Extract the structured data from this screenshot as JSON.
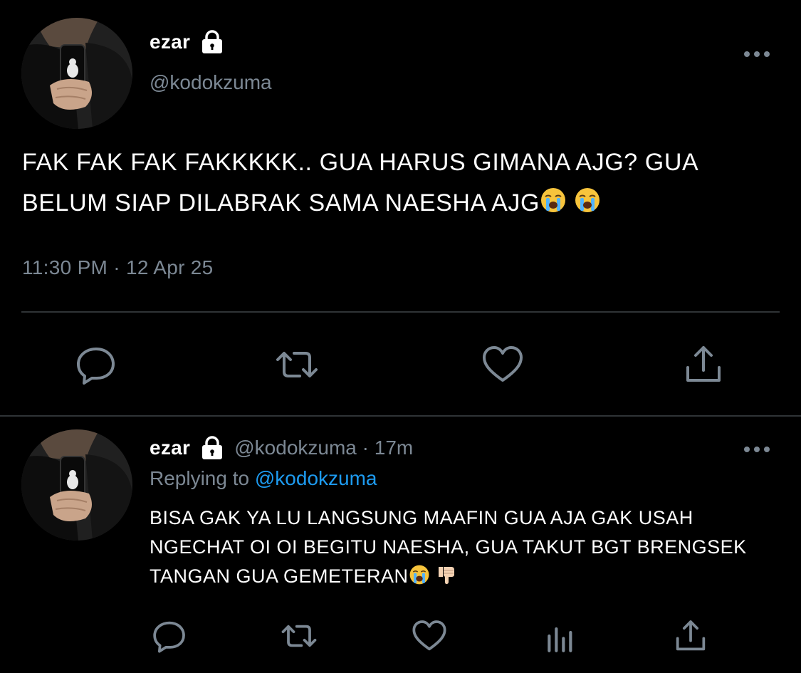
{
  "main_tweet": {
    "display_name": "ezar",
    "handle": "@kodokzuma",
    "text": "FAK FAK FAK FAKKKKK.. GUA HARUS GIMANA AJG? GUA BELUM SIAP DILABRAK SAMA NAESHA AJG",
    "emojis": [
      "loudly-crying-face",
      "loudly-crying-face"
    ],
    "timestamp": "11:30 PM · 12 Apr 25",
    "actions": [
      "reply-icon",
      "retweet-icon",
      "like-icon",
      "share-icon"
    ]
  },
  "reply_tweet": {
    "display_name": "ezar",
    "meta": "@kodokzuma · 17m",
    "replying_prefix": "Replying to",
    "replying_handle": "@kodokzuma",
    "text": "BISA GAK YA LU LANGSUNG MAAFIN GUA AJA GAK USAH NGECHAT OI OI BEGITU NAESHA, GUA TAKUT BGT BRENGSEK TANGAN GUA GEMETERAN",
    "emojis": [
      "loudly-crying-face",
      "thumbs-down"
    ],
    "actions": [
      "reply-icon",
      "retweet-icon",
      "like-icon",
      "analytics-icon",
      "share-icon"
    ]
  },
  "colors": {
    "background": "#000000",
    "text": "#ffffff",
    "secondary": "#7c8894",
    "link": "#1d9bf0",
    "divider": "#2f3336"
  }
}
